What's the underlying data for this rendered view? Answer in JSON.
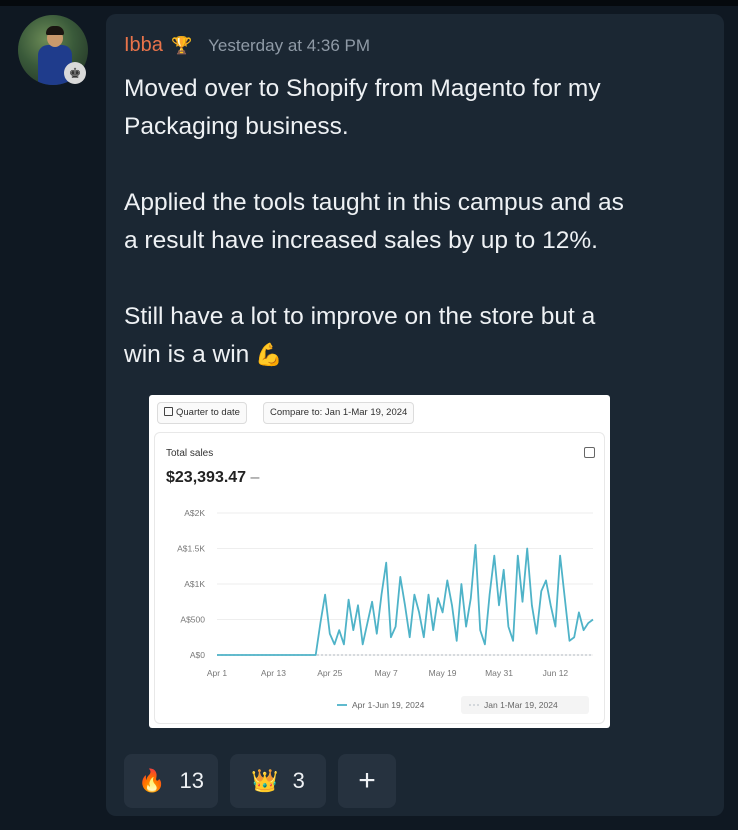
{
  "post": {
    "username": "Ibba",
    "timestamp": "Yesterday at 4:36 PM",
    "icons": {
      "avatar": "user-avatar",
      "role_badge": "chess-king-icon",
      "trophy": "trophy-icon"
    },
    "message": {
      "line1": "Moved over to Shopify from Magento for my",
      "line2": "Packaging business.",
      "line3": "Applied the tools taught in this campus and as",
      "line4": "a result have increased sales by up to 12%.",
      "line5": "Still have a lot to improve on the store but a",
      "line6": "win is a win",
      "emoji": "💪"
    }
  },
  "attachment": {
    "date_range_button": "Quarter to date",
    "compare_button": "Compare to: Jan 1-Mar 19, 2024",
    "metric_label": "Total sales",
    "metric_value": "$23,393.47",
    "metric_delta": "–",
    "colors": {
      "primary": "#4fb3c8",
      "comparison": "#c9ced4",
      "grid": "#eeeeee"
    }
  },
  "chart_data": {
    "type": "line",
    "title": "Total sales",
    "x_ticks": [
      "Apr 1",
      "Apr 13",
      "Apr 25",
      "May 7",
      "May 19",
      "May 31",
      "Jun 12"
    ],
    "y_ticks": [
      "A$0",
      "A$500",
      "A$1K",
      "A$1.5K",
      "A$2K"
    ],
    "ylim": [
      0,
      2000
    ],
    "grid": true,
    "legend_position": "bottom-right",
    "series": [
      {
        "name": "Apr 1–Jun 19, 2024",
        "x_days": [
          0,
          21,
          22,
          23,
          24,
          25,
          26,
          27,
          28,
          29,
          30,
          31,
          32,
          33,
          34,
          35,
          36,
          37,
          38,
          39,
          40,
          41,
          42,
          43,
          44,
          45,
          46,
          47,
          48,
          49,
          50,
          51,
          52,
          53,
          54,
          55,
          56,
          57,
          58,
          59,
          60,
          61,
          62,
          63,
          64,
          65,
          66,
          67,
          68,
          69,
          70,
          71,
          72,
          73,
          74,
          75,
          76,
          77,
          78,
          79,
          80
        ],
        "values": [
          0,
          0,
          450,
          850,
          300,
          150,
          350,
          150,
          780,
          350,
          700,
          150,
          450,
          750,
          300,
          850,
          1300,
          250,
          400,
          1100,
          700,
          250,
          850,
          600,
          250,
          850,
          350,
          800,
          600,
          1050,
          700,
          200,
          1000,
          400,
          800,
          1550,
          350,
          150,
          850,
          1400,
          700,
          1200,
          400,
          200,
          1400,
          750,
          1500,
          700,
          300,
          900,
          1050,
          700,
          400,
          1400,
          800,
          200,
          250,
          600,
          350,
          450,
          500
        ]
      },
      {
        "name": "Jan 1–Mar 19, 2024",
        "x_days": [
          0,
          80
        ],
        "values": [
          0,
          0
        ]
      }
    ]
  },
  "reactions": [
    {
      "icon": "fire-emoji-icon",
      "emoji": "🔥",
      "count": "13"
    },
    {
      "icon": "crown-emoji-icon",
      "emoji": "👑",
      "count": "3"
    }
  ],
  "add_reaction": "+"
}
